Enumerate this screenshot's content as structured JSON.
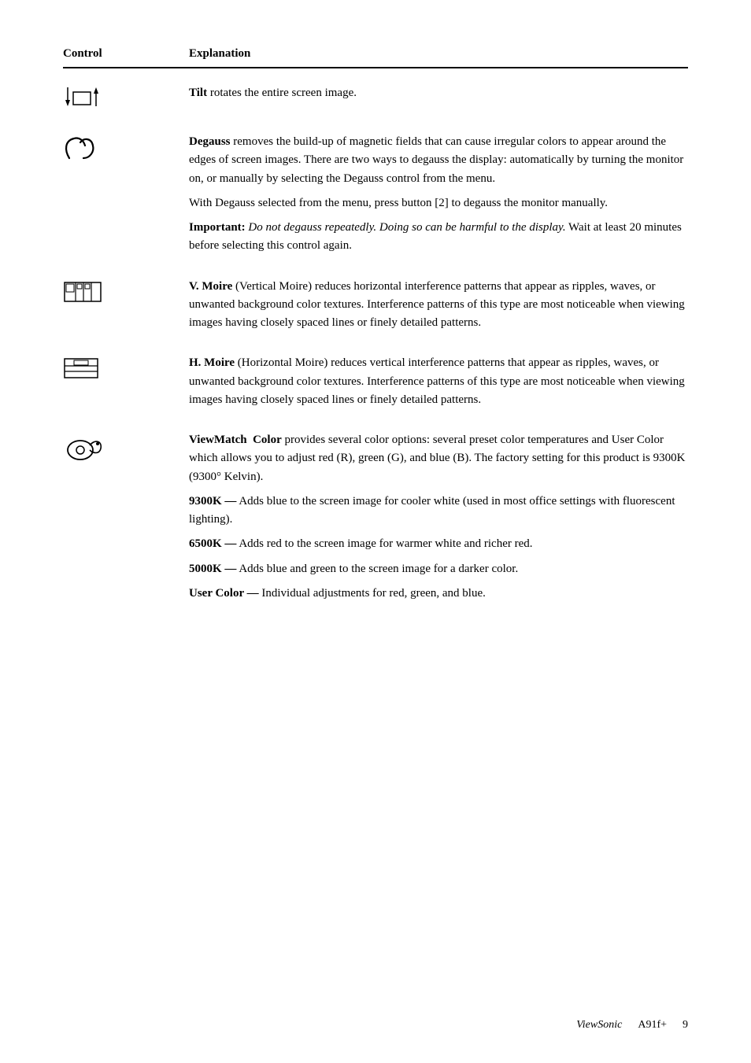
{
  "header": {
    "control": "Control",
    "explanation": "Explanation"
  },
  "rows": {
    "tilt": {
      "bold_word": "Tilt",
      "text": " rotates the entire screen image."
    },
    "degauss": {
      "bold_word": "Degauss",
      "text1": " removes the build-up of magnetic fields that can cause irregular colors to appear around the edges of screen images. There are two ways to degauss the display: automatically by turning the monitor on, or manually by selecting the Degauss control from the menu.",
      "text2": "With Degauss selected from the menu, press button [2] to degauss the monitor manually.",
      "important_bold": "Important:",
      "important_italic": " Do not degauss repeatedly. Doing so can be harmful to the display.",
      "important_end": " Wait at least 20 minutes before selecting this control again."
    },
    "vmoire": {
      "bold_word": "V. Moire",
      "text": " (Vertical Moire) reduces horizontal interference patterns that appear as ripples, waves, or unwanted background color textures. Interference patterns of this type are most noticeable when viewing images having closely spaced lines or finely detailed patterns."
    },
    "hmoire": {
      "bold_word": "H. Moire",
      "text": " (Horizontal Moire) reduces vertical interference patterns that appear as ripples, waves, or unwanted background color textures. Interference patterns of this type are most noticeable when viewing images having closely spaced lines or finely detailed patterns."
    },
    "viewmatch": {
      "bold_word": "ViewMatch   Color",
      "text1": " provides several color options: several preset color temperatures and User Color which allows you to adjust red (R), green (G), and blue (B). The factory setting for this product is 9300K (9300° Kelvin).",
      "option_9300k": "9300K —",
      "text_9300k": " Adds blue to the screen image for cooler white (used in most office settings with fluorescent lighting).",
      "option_6500k": "6500K —",
      "text_6500k": " Adds red to the screen image for warmer white and richer red.",
      "option_5000k": "5000K —",
      "text_5000k": " Adds blue and green to the screen image for a darker color.",
      "option_user": "User Color —",
      "text_user": " Individual adjustments for red, green, and blue."
    }
  },
  "footer": {
    "brand": "ViewSonic",
    "model": "A91f+",
    "page": "9"
  }
}
